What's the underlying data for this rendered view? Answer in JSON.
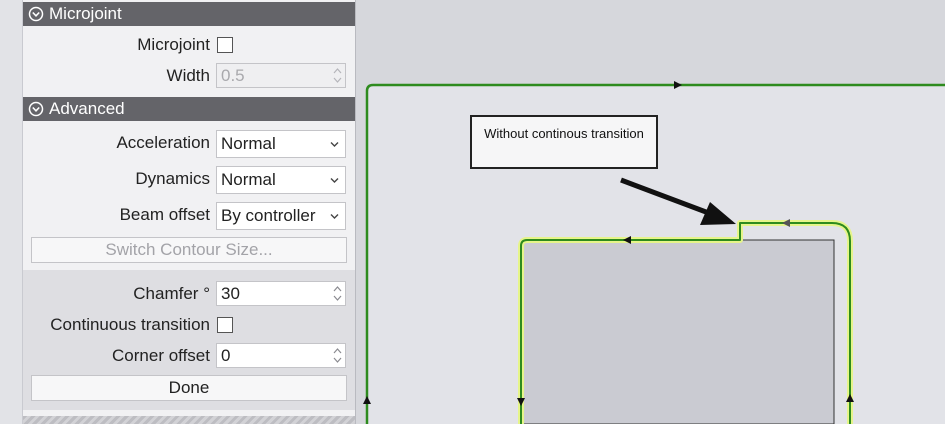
{
  "panel": {
    "microjoint_section": {
      "title": "Microjoint",
      "microjoint_label": "Microjoint",
      "microjoint_checked": false,
      "width_label": "Width",
      "width_value": "0.5"
    },
    "advanced_section": {
      "title": "Advanced",
      "acceleration_label": "Acceleration",
      "acceleration_value": "Normal",
      "dynamics_label": "Dynamics",
      "dynamics_value": "Normal",
      "beam_offset_label": "Beam offset",
      "beam_offset_value": "By controller",
      "switch_contour_label": "Switch Contour Size..."
    },
    "transition_group": {
      "chamfer_label": "Chamfer °",
      "chamfer_value": "30",
      "continuous_transition_label": "Continuous transition",
      "continuous_transition_checked": false,
      "corner_offset_label": "Corner offset",
      "corner_offset_value": "0",
      "done_label": "Done"
    }
  },
  "canvas": {
    "annotation_text": "Without continous transition",
    "colors": {
      "contour_green": "#2e8b1e",
      "highlight_yellow": "#e6f58a",
      "part_fill": "#cacbd2",
      "sheet_fill": "#e2e3e8",
      "background": "#d6d7dc"
    }
  }
}
